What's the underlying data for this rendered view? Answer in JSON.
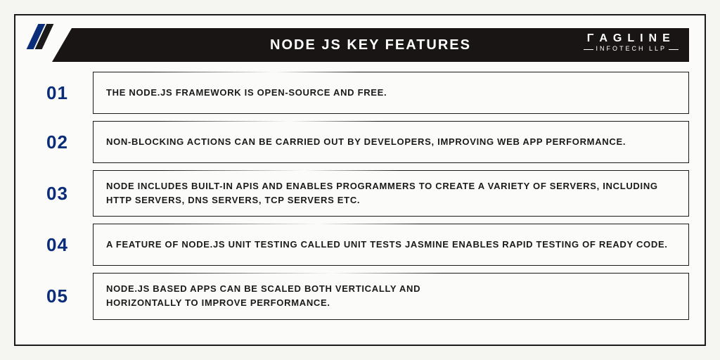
{
  "header": {
    "title": "NODE JS KEY FEATURES",
    "brand_top": "ΓAGLINE",
    "brand_sub": "INFOTECH LLP"
  },
  "features": [
    {
      "num": "01",
      "text": "THE NODE.JS FRAMEWORK IS OPEN-SOURCE AND FREE."
    },
    {
      "num": "02",
      "text": "NON-BLOCKING ACTIONS CAN BE CARRIED OUT BY DEVELOPERS, IMPROVING WEB APP PERFORMANCE."
    },
    {
      "num": "03",
      "text": "NODE INCLUDES BUILT-IN APIS AND ENABLES PROGRAMMERS TO CREATE A VARIETY OF SERVERS, INCLUDING HTTP SERVERS, DNS SERVERS, TCP SERVERS ETC."
    },
    {
      "num": "04",
      "text": "A FEATURE OF NODE.JS UNIT TESTING CALLED UNIT TESTS JASMINE ENABLES RAPID TESTING OF READY CODE."
    },
    {
      "num": "05",
      "text": "NODE.JS BASED APPS CAN BE SCALED BOTH VERTICALLY AND HORIZONTALLY TO IMPROVE PERFORMANCE."
    }
  ]
}
